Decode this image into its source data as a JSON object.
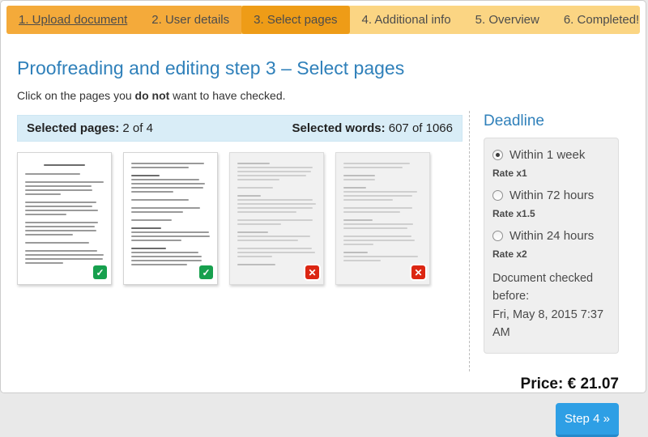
{
  "tabs": [
    {
      "label": "1. Upload document",
      "state": "done",
      "underline": true,
      "interactable": true
    },
    {
      "label": "2. User details",
      "state": "done",
      "underline": false,
      "interactable": true
    },
    {
      "label": "3. Select pages",
      "state": "active",
      "underline": false,
      "interactable": true
    },
    {
      "label": "4. Additional info",
      "state": "future",
      "underline": false,
      "interactable": false
    },
    {
      "label": "5. Overview",
      "state": "future",
      "underline": false,
      "interactable": false
    },
    {
      "label": "6. Completed!",
      "state": "future",
      "underline": false,
      "interactable": false
    }
  ],
  "header": {
    "title": "Proofreading and editing step 3 – Select pages",
    "instruction_before": "Click on the pages you ",
    "instruction_bold": "do not",
    "instruction_after": " want to have checked."
  },
  "stats": {
    "pages_label": "Selected pages:",
    "pages_value": " 2 of 4",
    "words_label": "Selected words:",
    "words_value": " 607 of 1066"
  },
  "pages": [
    {
      "name": "page-thumb-1",
      "selected": true,
      "status_icon": "check-icon",
      "glyph": "✓"
    },
    {
      "name": "page-thumb-2",
      "selected": true,
      "status_icon": "check-icon",
      "glyph": "✓"
    },
    {
      "name": "page-thumb-3",
      "selected": false,
      "status_icon": "x-icon",
      "glyph": "✕"
    },
    {
      "name": "page-thumb-4",
      "selected": false,
      "status_icon": "x-icon",
      "glyph": "✕"
    }
  ],
  "deadline": {
    "title": "Deadline",
    "options": [
      {
        "label": "Within 1 week",
        "rate": "Rate x1",
        "selected": true
      },
      {
        "label": "Within 72 hours",
        "rate": "Rate x1.5",
        "selected": false
      },
      {
        "label": "Within 24 hours",
        "rate": "Rate x2",
        "selected": false
      }
    ],
    "checked_before_label": "Document checked before:",
    "checked_before_value": "Fri, May 8, 2015 7:37 AM"
  },
  "footer": {
    "price_label": "Price:",
    "price_value": " € 21.07",
    "step_button": "Step 4 »"
  },
  "colors": {
    "tab_bar": "#fbd583",
    "tab_done": "#f4aa3a",
    "tab_active": "#ee9c17",
    "heading_blue": "#2f80ba",
    "stats_bg": "#d9edf7",
    "check_green": "#17a04e",
    "x_red": "#dc2612",
    "button_blue": "#2e9fe5"
  }
}
